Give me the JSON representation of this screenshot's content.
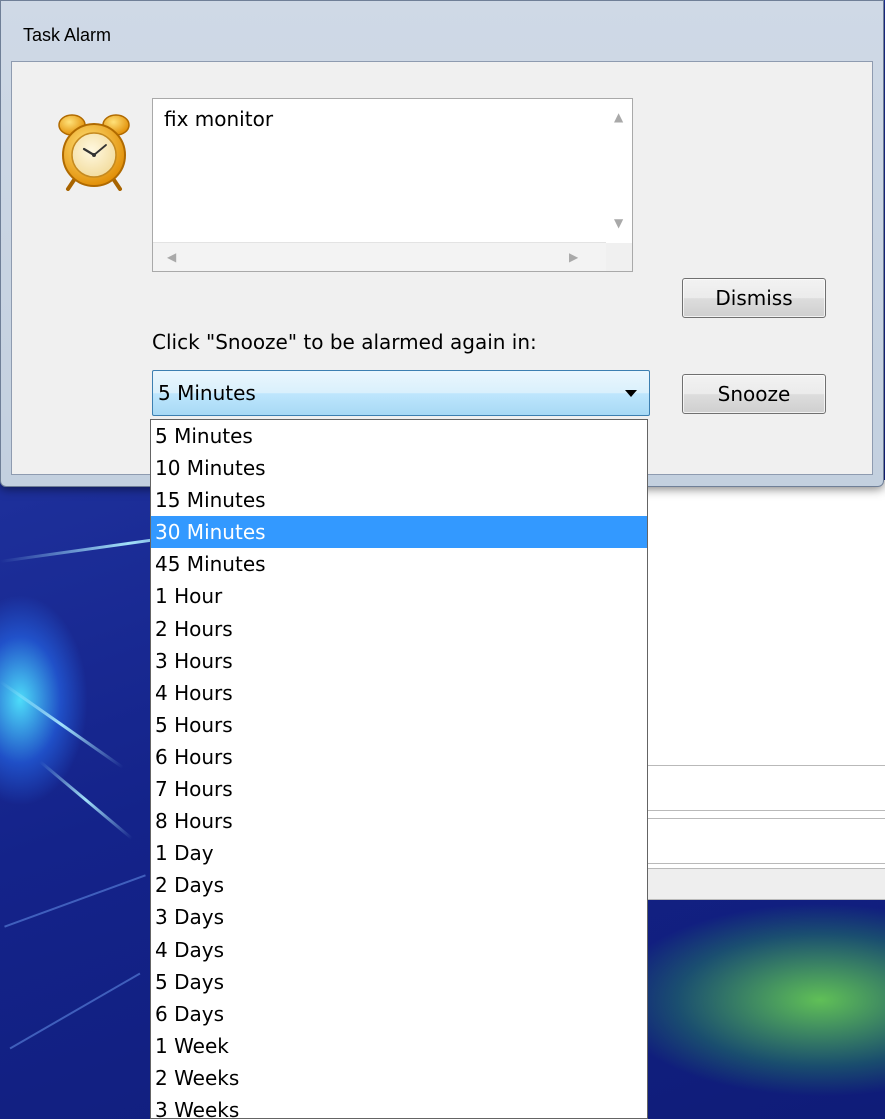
{
  "window": {
    "title": "Task Alarm"
  },
  "alarm": {
    "icon": "alarm-clock-icon",
    "note_text": "fix monitor"
  },
  "buttons": {
    "dismiss": "Dismiss",
    "snooze": "Snooze"
  },
  "snooze": {
    "label": "Click \"Snooze\" to be alarmed again in:",
    "selected_value": "5 Minutes",
    "highlighted_option": "30 Minutes",
    "options": [
      "5 Minutes",
      "10 Minutes",
      "15 Minutes",
      "30 Minutes",
      "45 Minutes",
      "1 Hour",
      "2 Hours",
      "3 Hours",
      "4 Hours",
      "5 Hours",
      "6 Hours",
      "7 Hours",
      "8 Hours",
      "1 Day",
      "2 Days",
      "3 Days",
      "4 Days",
      "5 Days",
      "6 Days",
      "1 Week",
      "2 Weeks",
      "3 Weeks"
    ]
  },
  "colors": {
    "highlight": "#3399ff",
    "combo_border": "#3c7fb1"
  }
}
